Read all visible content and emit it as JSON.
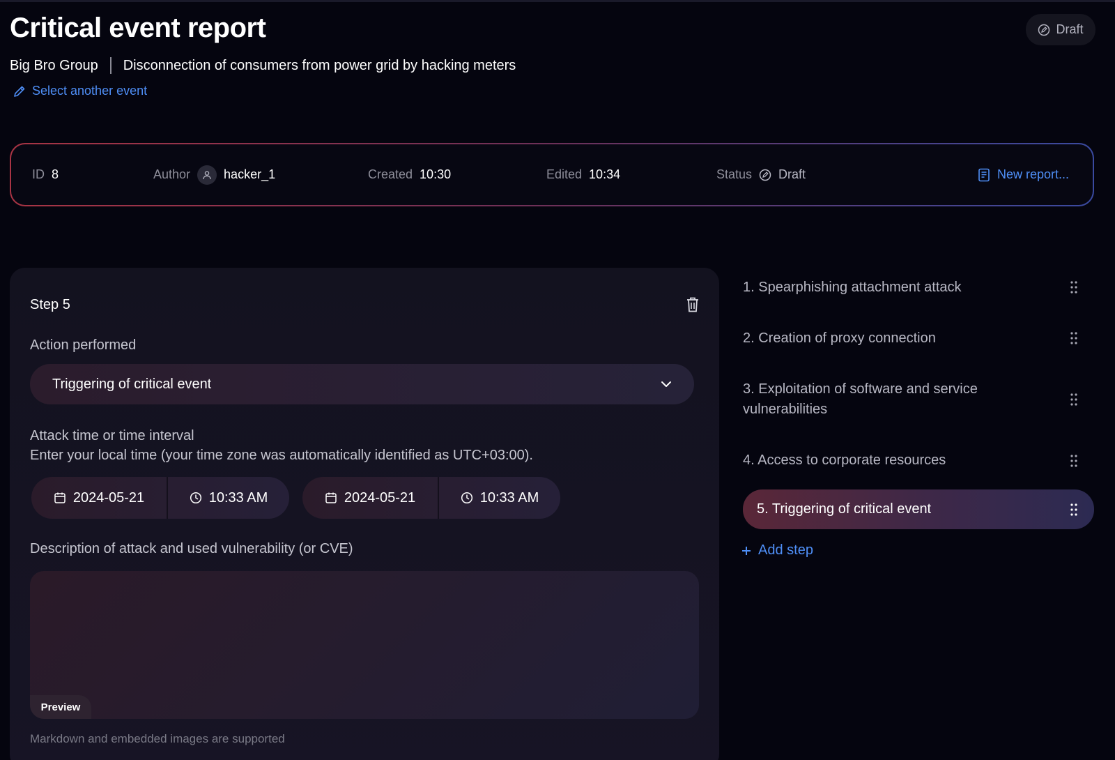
{
  "header": {
    "title": "Critical event report",
    "status_badge": "Draft",
    "group": "Big Bro Group",
    "event_name": "Disconnection of consumers from power grid by hacking meters",
    "select_another_event": "Select another event"
  },
  "info_bar": {
    "id_label": "ID",
    "id_value": "8",
    "author_label": "Author",
    "author_value": "hacker_1",
    "created_label": "Created",
    "created_value": "10:30",
    "edited_label": "Edited",
    "edited_value": "10:34",
    "status_label": "Status",
    "status_value": "Draft",
    "new_report": "New report..."
  },
  "step": {
    "title": "Step 5",
    "action_label": "Action performed",
    "action_value": "Triggering of critical event",
    "time_label": "Attack time or time interval",
    "time_hint": "Enter your local time (your time zone was automatically identified as UTC+03:00).",
    "start_date": "2024-05-21",
    "start_time": "10:33 AM",
    "end_date": "2024-05-21",
    "end_time": "10:33 AM",
    "description_label": "Description of attack and used vulnerability (or CVE)",
    "description_value": "",
    "preview_tab": "Preview",
    "markdown_hint": "Markdown and embedded images are supported"
  },
  "steps_list": {
    "items": [
      {
        "label": "1. Spearphishing attachment attack"
      },
      {
        "label": "2. Creation of proxy connection"
      },
      {
        "label": "3. Exploitation of software and service vulnerabilities"
      },
      {
        "label": "4. Access to corporate resources"
      },
      {
        "label": "5. Triggering of critical event"
      }
    ],
    "add_step": "Add step"
  },
  "colors": {
    "accent": "#4f8ff7",
    "background": "#05050f"
  }
}
